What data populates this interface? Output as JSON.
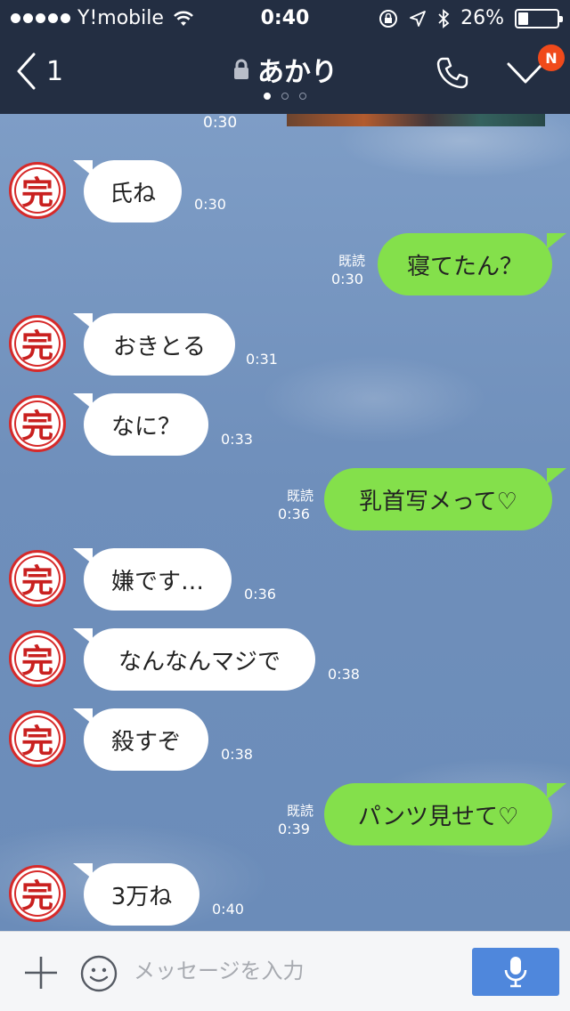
{
  "status_bar": {
    "carrier": "Y!mobile",
    "time": "0:40",
    "battery": "26%",
    "battery_level": 0.26
  },
  "header": {
    "back_count": "1",
    "title": "あかり",
    "page_dots": 3,
    "active_page": 0,
    "badge": "N",
    "icons": [
      "back-chevron-icon",
      "lock-icon",
      "phone-icon",
      "chevron-down-icon"
    ]
  },
  "chat": {
    "top_time": "0:30",
    "avatar_char": "完",
    "read_label": "既読",
    "messages": [
      {
        "side": "in",
        "text": "氏ね",
        "time": "0:30"
      },
      {
        "side": "out",
        "text": "寝てたん？",
        "time": "0:30",
        "read": true
      },
      {
        "side": "in",
        "text": "おきとる",
        "time": "0:31"
      },
      {
        "side": "in",
        "text": "なに？",
        "time": "0:33"
      },
      {
        "side": "out",
        "text": "乳首写メって♡",
        "time": "0:36",
        "read": true
      },
      {
        "side": "in",
        "text": "嫌です…",
        "time": "0:36"
      },
      {
        "side": "in",
        "text": "なんなんマジで",
        "time": "0:38"
      },
      {
        "side": "in",
        "text": "殺すぞ",
        "time": "0:38"
      },
      {
        "side": "out",
        "text": "パンツ見せて♡",
        "time": "0:39",
        "read": true
      },
      {
        "side": "in",
        "text": "3万ね",
        "time": "0:40"
      }
    ]
  },
  "input_bar": {
    "placeholder": "メッセージを入力",
    "icons": [
      "plus-icon",
      "smiley-icon",
      "microphone-icon"
    ]
  },
  "colors": {
    "header_bg": "#232e42",
    "outgoing_bubble": "#84e04b",
    "incoming_bubble": "#ffffff",
    "badge": "#f04a1b",
    "mic_button": "#4f87dc"
  }
}
